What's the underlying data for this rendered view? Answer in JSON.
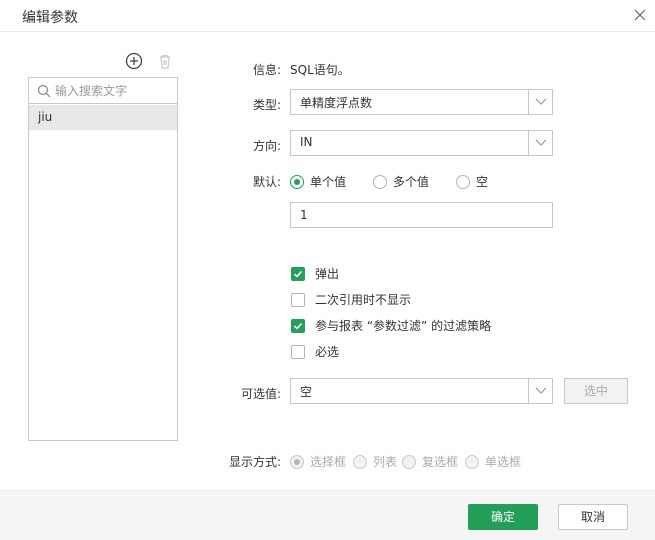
{
  "dialog": {
    "title": "编辑参数"
  },
  "left_panel": {
    "search_placeholder": "输入搜索文字",
    "items": [
      {
        "label": "jiu"
      }
    ]
  },
  "form": {
    "info_label": "信息:",
    "info_value": "SQL语句。",
    "type_label": "类型:",
    "type_value": "单精度浮点数",
    "direction_label": "方向:",
    "direction_value": "IN",
    "default_label": "默认:",
    "default_options": [
      {
        "label": "单个值",
        "selected": true
      },
      {
        "label": "多个值",
        "selected": false
      },
      {
        "label": "空",
        "selected": false
      }
    ],
    "default_value": "1",
    "checkboxes": [
      {
        "label": "弹出",
        "checked": true
      },
      {
        "label": "二次引用时不显示",
        "checked": false
      },
      {
        "label": "参与报表 “参数过滤” 的过滤策略",
        "checked": true
      },
      {
        "label": "必选",
        "checked": false
      }
    ],
    "optional_label": "可选值:",
    "optional_value": "空",
    "select_button": "选中",
    "display_label": "显示方式:",
    "display_options": [
      {
        "label": "选择框",
        "selected": true
      },
      {
        "label": "列表",
        "selected": false
      },
      {
        "label": "复选框",
        "selected": false
      },
      {
        "label": "单选框",
        "selected": false
      }
    ]
  },
  "footer": {
    "ok": "确定",
    "cancel": "取消"
  },
  "colors": {
    "accent": "#22a05a",
    "border": "#c8c8c8",
    "footer_bg": "#f5f5f5"
  }
}
